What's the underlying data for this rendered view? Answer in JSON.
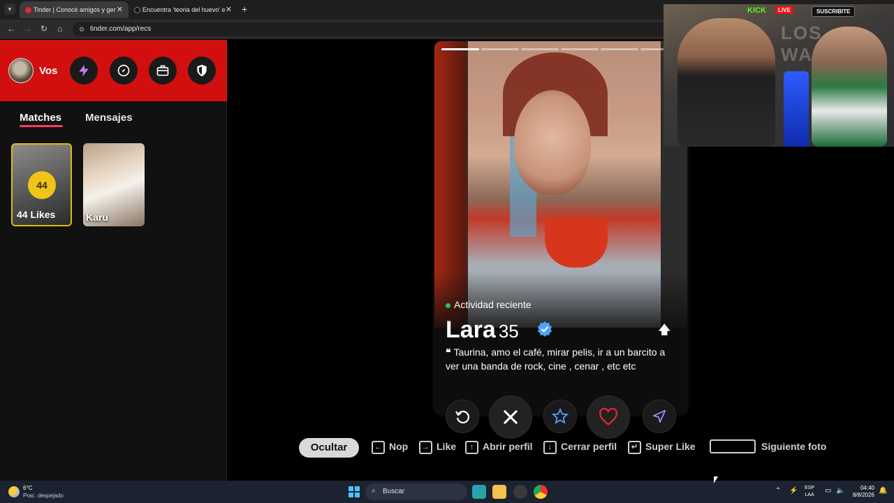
{
  "browser": {
    "tabs": [
      {
        "title": "Tinder | Conocé amigos y gente",
        "active": true,
        "favicon_color": "#e3243b"
      },
      {
        "title": "Encuentra 'teoria del huevo' en",
        "active": false,
        "favicon_color": "#111111"
      }
    ],
    "tab_close": "✕",
    "new_tab": "+",
    "url": "tinder.com/app/recs",
    "nav": {
      "back": "←",
      "forward": "→",
      "reload": "↻",
      "home": "⌂",
      "site_info": "⚙"
    }
  },
  "sidebar": {
    "profile_label": "Vos",
    "header_buttons": [
      "lightning-icon",
      "compass-icon",
      "briefcase-icon",
      "shield-icon"
    ],
    "tabs": [
      {
        "label": "Matches",
        "active": true
      },
      {
        "label": "Mensajes",
        "active": false
      }
    ],
    "likes_card": {
      "count": "44",
      "label": "44 Likes"
    },
    "matches": [
      {
        "name": "Karu"
      }
    ]
  },
  "profile": {
    "activity": "Actividad reciente",
    "name": "Lara",
    "age": "35",
    "verified": true,
    "quote_mark": "❝",
    "bio": "Taurina, amo el café, mirar pelis, ir a un barcito a ver una banda de rock, cine , cenar , etc etc",
    "photo_count": 6,
    "current_photo": 1
  },
  "actions": [
    "rewind-icon",
    "nope-icon",
    "super-like-icon",
    "like-icon",
    "boost-icon"
  ],
  "shortcuts": {
    "hide_label": "Ocultar",
    "items": [
      {
        "key": "←",
        "label": "Nop"
      },
      {
        "key": "→",
        "label": "Like"
      },
      {
        "key": "↑",
        "label": "Abrir perfil"
      },
      {
        "key": "↓",
        "label": "Cerrar perfil"
      },
      {
        "key": "↵",
        "label": "Super Like"
      }
    ],
    "next_photo_label": "Siguiente foto"
  },
  "stream_overlay": {
    "platform": "KICK",
    "live": "LIVE",
    "subscribe": "SUSCRIBITE",
    "logo": "LOS WARINO"
  },
  "taskbar": {
    "weather_temp": "6°C",
    "weather_desc": "Prac. despejado",
    "search_placeholder": "Buscar",
    "lang_top": "ESP",
    "lang_bottom": "LAA",
    "time": "04:40",
    "date": "8/8/2026"
  },
  "colors": {
    "tinder_red": "#d10f0f",
    "accent_pink": "#ff3c5f",
    "likes_gold": "#f0c419",
    "online_green": "#22c55e",
    "nope_white": "#ffffff",
    "like_red": "#e3243b",
    "star_blue": "#4ea3ff"
  }
}
